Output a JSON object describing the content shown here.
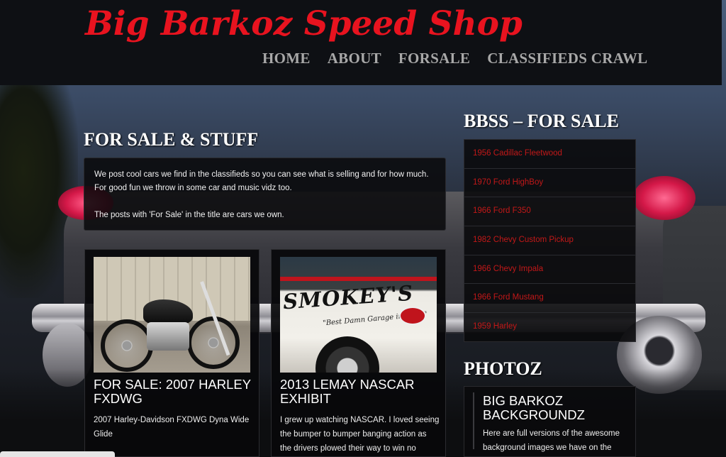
{
  "site": {
    "title": "Big Barkoz Speed Shop"
  },
  "nav": {
    "items": [
      {
        "label": "HOME"
      },
      {
        "label": "ABOUT"
      },
      {
        "label": "FORSALE"
      },
      {
        "label": "CLASSIFIEDS CRAWL"
      }
    ]
  },
  "main": {
    "heading": "FOR SALE & STUFF",
    "intro": {
      "p1": "We post cool cars we find in the classifieds so you can see what is selling and for how much. For good fun we throw in some car and music vidz too.",
      "p2": "The posts with 'For Sale' in the title are cars we own."
    },
    "posts": [
      {
        "title": "FOR SALE: 2007 HARLEY FXDWG",
        "excerpt": "2007 Harley-Davidson FXDWG Dyna Wide Glide"
      },
      {
        "title": "2013 LEMAY NASCAR EXHIBIT",
        "excerpt": "I grew up watching NASCAR.  I loved seeing the bumper to bumper banging action as the drivers plowed their way to win no matter"
      }
    ],
    "thumb_text": {
      "sign": "SMOKEY'S",
      "sub": "\"Best Damn Garage in Town\""
    }
  },
  "sidebar": {
    "forsale": {
      "heading": "BBSS – FOR SALE",
      "items": [
        "1956 Cadillac Fleetwood",
        "1970 Ford HighBoy",
        "1966 Ford F350",
        "1982 Chevy Custom Pickup",
        "1966 Chevy Impala",
        "1966 Ford Mustang",
        "1959 Harley"
      ]
    },
    "photoz": {
      "heading": "PHOTOZ",
      "post_title": "BIG BARKOZ BACKGROUNDZ",
      "excerpt": "Here are full versions of the awesome background images we have on the"
    }
  },
  "colors": {
    "brand_red": "#e8131f",
    "link_red": "#c21818",
    "header_bg": "#0e1014"
  }
}
